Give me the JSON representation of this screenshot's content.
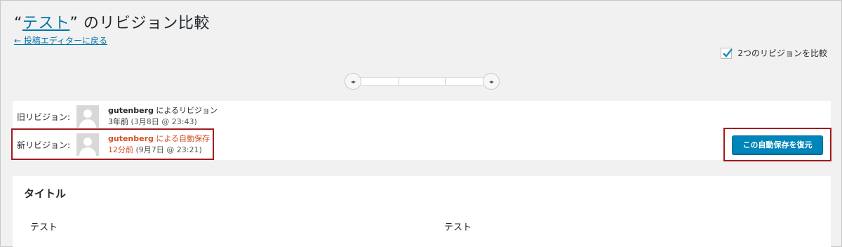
{
  "header": {
    "title_prefix": "“",
    "title_link": "テスト",
    "title_suffix": "” のリビジョン比較",
    "back_link": "← 投稿エディターに戻る"
  },
  "options": {
    "compare_two_label": "2つのリビジョンを比較",
    "compare_two_checked": true
  },
  "slider": {
    "left_handle": "◂▸",
    "right_handle": "◂▸"
  },
  "revisions": {
    "old": {
      "label": "旧リビジョン:",
      "author": "gutenberg",
      "action": " によるリビジョン",
      "ago": "3年前",
      "date": " (3月8日 @ 23:43)"
    },
    "new": {
      "label": "新リビジョン:",
      "author": "gutenberg",
      "action": " による自動保存",
      "ago": "12分前",
      "date": " (9月7日 @ 23:21)"
    },
    "restore_button": "この自動保存を復元"
  },
  "diff": {
    "section_title": "タイトル",
    "left_value": "テスト",
    "right_value": "テスト"
  },
  "colors": {
    "link": "#0073aa",
    "autosave_text": "#d54e21",
    "highlight_border": "#a31a1e",
    "primary_button": "#0085ba"
  }
}
